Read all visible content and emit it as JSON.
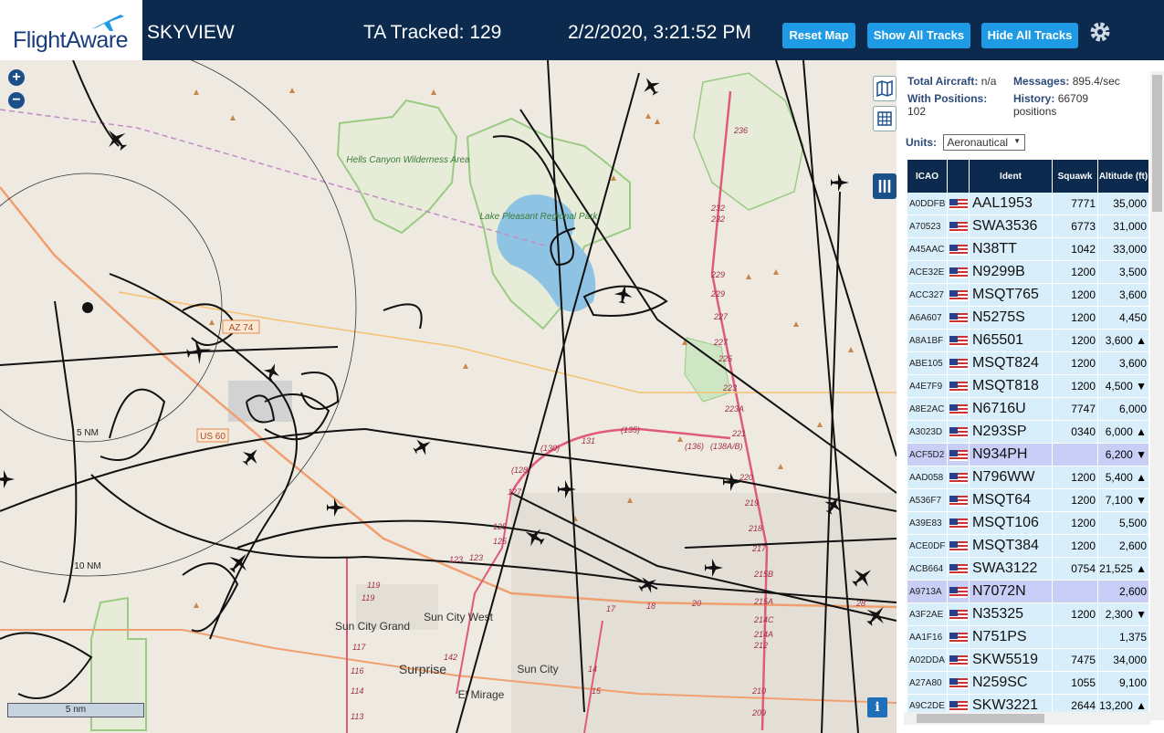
{
  "header": {
    "logo_text": "FlightAware",
    "app_title": "SKYVIEW",
    "tracked": "TA Tracked: 129",
    "datetime": "2/2/2020, 3:21:52 PM",
    "reset_label": "Reset Map",
    "show_label": "Show All Tracks",
    "hide_label": "Hide All Tracks"
  },
  "map": {
    "zoom_in": "+",
    "zoom_out": "−",
    "scale_label": "5 nm",
    "range_rings": [
      "5 NM",
      "10 NM"
    ],
    "info_label": "i",
    "places": [
      {
        "name": "Hells Canyon Wilderness Area"
      },
      {
        "name": "Lake Pleasant Regional Park"
      },
      {
        "name": "Sun City Grand"
      },
      {
        "name": "Sun City West"
      },
      {
        "name": "Surprise"
      },
      {
        "name": "Sun City"
      },
      {
        "name": "El Mirage"
      }
    ],
    "road_labels": [
      "AZ 74",
      "US 60",
      "236",
      "232",
      "232",
      "229",
      "229",
      "227",
      "227",
      "225",
      "223",
      "223A",
      "221",
      "220",
      "219",
      "218",
      "217",
      "215B",
      "215A",
      "214C",
      "214A",
      "212",
      "210",
      "209",
      "(135)",
      "(130)",
      "(128)",
      "127",
      "125",
      "125",
      "123",
      "123",
      "131",
      "(136)",
      "(138A/B)",
      "119",
      "119",
      "117",
      "116",
      "114",
      "113",
      "142",
      "14",
      "15",
      "17",
      "18",
      "20",
      "28"
    ]
  },
  "panel": {
    "total_aircraft_label": "Total Aircraft:",
    "total_aircraft_value": "n/a",
    "messages_label": "Messages:",
    "messages_value": "895.4/sec",
    "with_positions_label": "With Positions:",
    "with_positions_value": "102",
    "history_label": "History:",
    "history_value": "66709 positions",
    "units_label": "Units:",
    "units_value": "Aeronautical",
    "columns": [
      "ICAO",
      "",
      "Ident",
      "Squawk",
      "Altitude (ft)"
    ],
    "rows": [
      {
        "icao": "A0DDFB",
        "ident": "AAL1953",
        "squawk": "7771",
        "alt": "35,000",
        "sel": false
      },
      {
        "icao": "A70523",
        "ident": "SWA3536",
        "squawk": "6773",
        "alt": "31,000",
        "sel": false
      },
      {
        "icao": "A45AAC",
        "ident": "N38TT",
        "squawk": "1042",
        "alt": "33,000",
        "sel": false
      },
      {
        "icao": "ACE32E",
        "ident": "N9299B",
        "squawk": "1200",
        "alt": "3,500",
        "sel": false
      },
      {
        "icao": "ACC327",
        "ident": "MSQT765",
        "squawk": "1200",
        "alt": "3,600",
        "sel": false
      },
      {
        "icao": "A6A607",
        "ident": "N5275S",
        "squawk": "1200",
        "alt": "4,450",
        "sel": false
      },
      {
        "icao": "A8A1BF",
        "ident": "N65501",
        "squawk": "1200",
        "alt": "3,600 ▲",
        "sel": false
      },
      {
        "icao": "ABE105",
        "ident": "MSQT824",
        "squawk": "1200",
        "alt": "3,600",
        "sel": false
      },
      {
        "icao": "A4E7F9",
        "ident": "MSQT818",
        "squawk": "1200",
        "alt": "4,500 ▼",
        "sel": false
      },
      {
        "icao": "A8E2AC",
        "ident": "N6716U",
        "squawk": "7747",
        "alt": "6,000",
        "sel": false
      },
      {
        "icao": "A3023D",
        "ident": "N293SP",
        "squawk": "0340",
        "alt": "6,000 ▲",
        "sel": false
      },
      {
        "icao": "ACF5D2",
        "ident": "N934PH",
        "squawk": "",
        "alt": "6,200 ▼",
        "sel": true
      },
      {
        "icao": "AAD058",
        "ident": "N796WW",
        "squawk": "1200",
        "alt": "5,400 ▲",
        "sel": false
      },
      {
        "icao": "A536F7",
        "ident": "MSQT64",
        "squawk": "1200",
        "alt": "7,100 ▼",
        "sel": false
      },
      {
        "icao": "A39E83",
        "ident": "MSQT106",
        "squawk": "1200",
        "alt": "5,500",
        "sel": false
      },
      {
        "icao": "ACE0DF",
        "ident": "MSQT384",
        "squawk": "1200",
        "alt": "2,600",
        "sel": false
      },
      {
        "icao": "ACB664",
        "ident": "SWA3122",
        "squawk": "0754",
        "alt": "21,525 ▲",
        "sel": false
      },
      {
        "icao": "A9713A",
        "ident": "N7072N",
        "squawk": "",
        "alt": "2,600",
        "sel": true
      },
      {
        "icao": "A3F2AE",
        "ident": "N35325",
        "squawk": "1200",
        "alt": "2,300 ▼",
        "sel": false
      },
      {
        "icao": "AA1F16",
        "ident": "N751PS",
        "squawk": "",
        "alt": "1,375",
        "sel": false
      },
      {
        "icao": "A02DDA",
        "ident": "SKW5519",
        "squawk": "7475",
        "alt": "34,000",
        "sel": false
      },
      {
        "icao": "A27A80",
        "ident": "N259SC",
        "squawk": "1055",
        "alt": "9,100",
        "sel": false
      },
      {
        "icao": "A9C2DE",
        "ident": "SKW3221",
        "squawk": "2644",
        "alt": "13,200 ▲",
        "sel": false
      }
    ]
  },
  "colors": {
    "header_bg": "#0b2a4e",
    "button_bg": "#1e9be4",
    "row_bg": "#d9eefb",
    "row_selected_bg": "#c8cef5",
    "track": "#111111",
    "lake": "#8ec3e3",
    "park_border": "#9acb82"
  }
}
